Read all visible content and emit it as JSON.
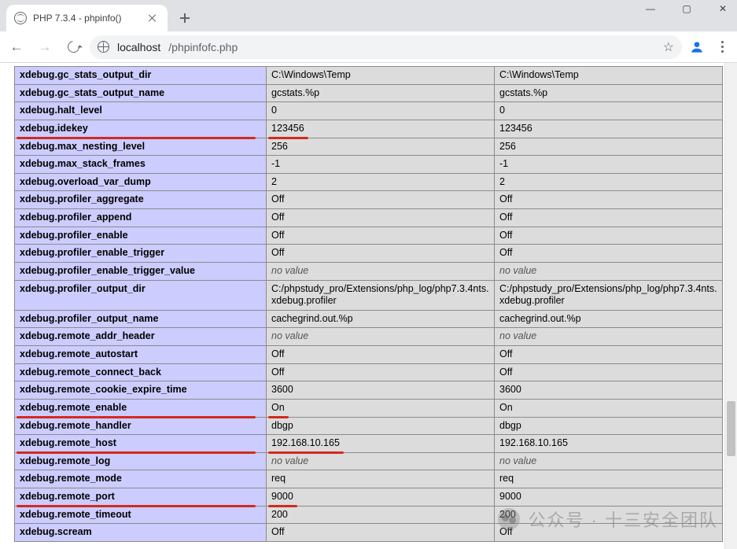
{
  "browser": {
    "tab_title": "PHP 7.3.4 - phpinfo()",
    "url_host": "localhost",
    "url_path": "/phpinfofc.php"
  },
  "rows": [
    {
      "name": "xdebug.gc_stats_output_dir",
      "local": "C:\\Windows\\Temp",
      "master": "C:\\Windows\\Temp"
    },
    {
      "name": "xdebug.gc_stats_output_name",
      "local": "gcstats.%p",
      "master": "gcstats.%p"
    },
    {
      "name": "xdebug.halt_level",
      "local": "0",
      "master": "0"
    },
    {
      "name": "xdebug.idekey",
      "local": "123456",
      "master": "123456",
      "hl": true
    },
    {
      "name": "xdebug.max_nesting_level",
      "local": "256",
      "master": "256"
    },
    {
      "name": "xdebug.max_stack_frames",
      "local": "-1",
      "master": "-1"
    },
    {
      "name": "xdebug.overload_var_dump",
      "local": "2",
      "master": "2"
    },
    {
      "name": "xdebug.profiler_aggregate",
      "local": "Off",
      "master": "Off"
    },
    {
      "name": "xdebug.profiler_append",
      "local": "Off",
      "master": "Off"
    },
    {
      "name": "xdebug.profiler_enable",
      "local": "Off",
      "master": "Off"
    },
    {
      "name": "xdebug.profiler_enable_trigger",
      "local": "Off",
      "master": "Off"
    },
    {
      "name": "xdebug.profiler_enable_trigger_value",
      "local": "no value",
      "master": "no value",
      "novalue": true
    },
    {
      "name": "xdebug.profiler_output_dir",
      "local": "C:/phpstudy_pro/Extensions/php_log/php7.3.4nts.xdebug.profiler",
      "master": "C:/phpstudy_pro/Extensions/php_log/php7.3.4nts.xdebug.profiler"
    },
    {
      "name": "xdebug.profiler_output_name",
      "local": "cachegrind.out.%p",
      "master": "cachegrind.out.%p"
    },
    {
      "name": "xdebug.remote_addr_header",
      "local": "no value",
      "master": "no value",
      "novalue": true
    },
    {
      "name": "xdebug.remote_autostart",
      "local": "Off",
      "master": "Off"
    },
    {
      "name": "xdebug.remote_connect_back",
      "local": "Off",
      "master": "Off"
    },
    {
      "name": "xdebug.remote_cookie_expire_time",
      "local": "3600",
      "master": "3600"
    },
    {
      "name": "xdebug.remote_enable",
      "local": "On",
      "master": "On",
      "hl": true
    },
    {
      "name": "xdebug.remote_handler",
      "local": "dbgp",
      "master": "dbgp"
    },
    {
      "name": "xdebug.remote_host",
      "local": "192.168.10.165",
      "master": "192.168.10.165",
      "hl": true
    },
    {
      "name": "xdebug.remote_log",
      "local": "no value",
      "master": "no value",
      "novalue": true
    },
    {
      "name": "xdebug.remote_mode",
      "local": "req",
      "master": "req"
    },
    {
      "name": "xdebug.remote_port",
      "local": "9000",
      "master": "9000",
      "hl": true
    },
    {
      "name": "xdebug.remote_timeout",
      "local": "200",
      "master": "200"
    },
    {
      "name": "xdebug.scream",
      "local": "Off",
      "master": "Off"
    }
  ],
  "watermark": "公众号 · 十三安全团队"
}
